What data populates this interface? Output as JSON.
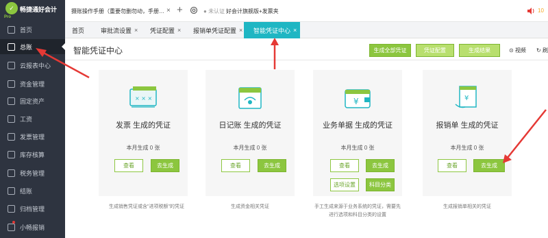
{
  "app": {
    "logo_text": "畅捷通好会计",
    "logo_sub": "Pro",
    "doc_tab": "摄账操作手册（重要勿删勿动，手册…",
    "cert_status": "未认证",
    "promo": "好会计旗舰版+发票夹",
    "top_right": "10"
  },
  "sidebar": {
    "items": [
      {
        "label": "首页",
        "icon": "home-icon"
      },
      {
        "label": "总账",
        "icon": "ledger-icon",
        "active": true
      },
      {
        "label": "云报表中心",
        "icon": "report-icon"
      },
      {
        "label": "资金管理",
        "icon": "money-icon"
      },
      {
        "label": "固定资产",
        "icon": "asset-icon"
      },
      {
        "label": "工资",
        "icon": "salary-icon"
      },
      {
        "label": "发票管理",
        "icon": "invoice-icon"
      },
      {
        "label": "库存核算",
        "icon": "inventory-icon"
      },
      {
        "label": "税务管理",
        "icon": "tax-icon"
      },
      {
        "label": "结账",
        "icon": "close-account-icon"
      },
      {
        "label": "归档管理",
        "icon": "archive-icon"
      },
      {
        "label": "小畅报销",
        "icon": "reimburse-icon"
      }
    ]
  },
  "tabs": [
    {
      "label": "首页",
      "closable": false
    },
    {
      "label": "审批流设置",
      "closable": true
    },
    {
      "label": "凭证配置",
      "closable": true
    },
    {
      "label": "报销单凭证配置",
      "closable": true
    },
    {
      "label": "智能凭证中心",
      "closable": true,
      "active": true
    }
  ],
  "tab_close_glyph": "×",
  "header": {
    "title": "智能凭证中心",
    "btn_generate_all": "生成全部凭证",
    "btn_config": "凭证配置",
    "btn_result": "生成结果",
    "video": "视频",
    "refresh": "刷"
  },
  "cards": [
    {
      "title": "发票 生成的凭证",
      "count": "本月生成 0 张",
      "view": "查看",
      "generate": "去生成",
      "desc": "生成销售凭证或含\"进项税额\"的凭证"
    },
    {
      "title": "日记账 生成的凭证",
      "count": "本月生成 0 张",
      "view": "查看",
      "generate": "去生成",
      "desc": "生成资金相关凭证"
    },
    {
      "title": "业务单据 生成的凭证",
      "count": "本月生成 0 张",
      "view": "查看",
      "generate": "去生成",
      "option": "选项设置",
      "subject": "科目分类",
      "desc": "手工生成来源于业务系统的凭证，需要先进行选项和科目分类的设置"
    },
    {
      "title": "报销单 生成的凭证",
      "count": "本月生成 0 张",
      "view": "查看",
      "generate": "去生成",
      "desc": "生成报销单相关的凭证"
    }
  ],
  "colors": {
    "sidebar_bg": "#2e3440",
    "accent_green": "#8cc63f",
    "active_tab": "#1fb6c3",
    "annotation_red": "#e53935"
  }
}
